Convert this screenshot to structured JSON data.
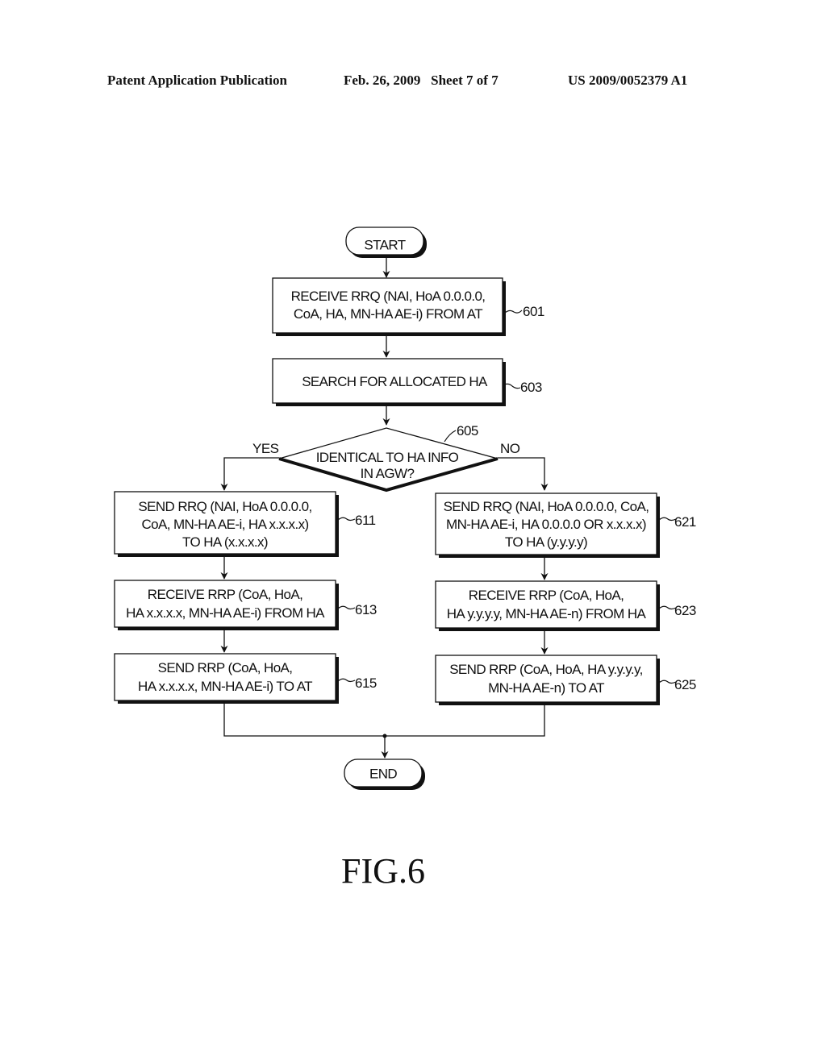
{
  "header": {
    "publication": "Patent Application Publication",
    "date_sheet": "Feb. 26, 2009   Sheet 7 of 7",
    "patent_number": "US 2009/0052379 A1"
  },
  "flowchart": {
    "start": "START",
    "end": "END",
    "steps": {
      "s601": {
        "ref": "601",
        "lines": [
          "RECEIVE RRQ (NAI, HoA 0.0.0.0,",
          "CoA, HA, MN-HA AE-i) FROM AT"
        ]
      },
      "s603": {
        "ref": "603",
        "lines": [
          "SEARCH FOR ALLOCATED HA"
        ]
      },
      "s605": {
        "ref": "605",
        "lines": [
          "IDENTICAL TO HA INFO",
          "IN AGW?"
        ],
        "yes": "YES",
        "no": "NO"
      },
      "s611": {
        "ref": "611",
        "lines": [
          "SEND RRQ (NAI, HoA 0.0.0.0,",
          "CoA, MN-HA AE-i, HA x.x.x.x)",
          "TO HA (x.x.x.x)"
        ]
      },
      "s613": {
        "ref": "613",
        "lines": [
          "RECEIVE RRP (CoA, HoA,",
          "HA x.x.x.x, MN-HA AE-i) FROM HA"
        ]
      },
      "s615": {
        "ref": "615",
        "lines": [
          "SEND RRP (CoA, HoA,",
          "HA x.x.x.x, MN-HA AE-i) TO AT"
        ]
      },
      "s621": {
        "ref": "621",
        "lines": [
          "SEND RRQ (NAI, HoA 0.0.0.0, CoA,",
          "MN-HA AE-i, HA 0.0.0.0 OR x.x.x.x)",
          "TO HA (y.y.y.y)"
        ]
      },
      "s623": {
        "ref": "623",
        "lines": [
          "RECEIVE RRP (CoA, HoA,",
          "HA y.y.y.y, MN-HA AE-n) FROM HA"
        ]
      },
      "s625": {
        "ref": "625",
        "lines": [
          "SEND RRP (CoA, HoA, HA y.y.y.y,",
          "MN-HA AE-n) TO AT"
        ]
      }
    }
  },
  "figure_label": "FIG.6"
}
